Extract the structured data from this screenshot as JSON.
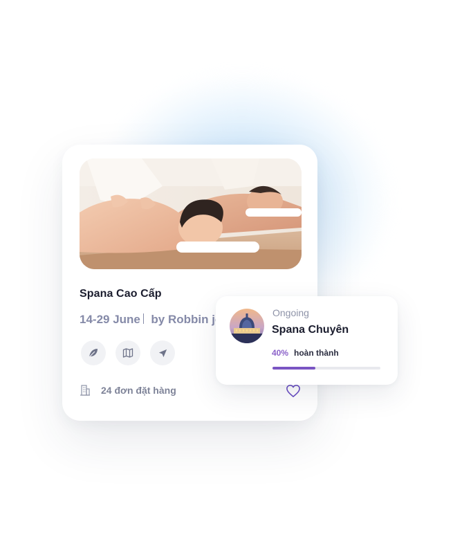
{
  "card": {
    "title": "Spana Cao Cấp",
    "dates": "14-29 June",
    "author": "by Robbin jo",
    "photo_icon": "spa-massage-photo",
    "actions": [
      {
        "icon": "leaf-icon"
      },
      {
        "icon": "map-icon"
      },
      {
        "icon": "send-icon"
      }
    ],
    "orders_icon": "building-icon",
    "orders_label": "24 đơn đặt hàng",
    "favorite_icon": "heart-icon"
  },
  "progress": {
    "status": "Ongoing",
    "title": "Spana Chuyên",
    "percent_label": "40%",
    "percent_value": 0.4,
    "done_label": "hoàn thành",
    "avatar_icon": "cathedral-photo"
  },
  "colors": {
    "accent": "#7a55c3",
    "text_dark": "#1b1d2e",
    "text_muted": "#858aa8",
    "glow": "#a6d2f5"
  }
}
